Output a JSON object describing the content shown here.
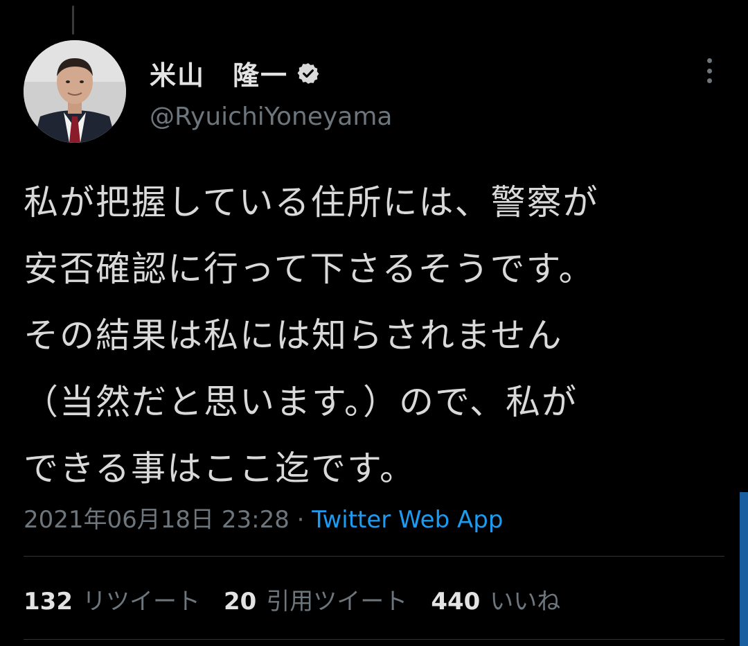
{
  "author": {
    "display_name": "米山　隆一",
    "handle": "@RyuichiYoneyama",
    "verified": true
  },
  "icons": {
    "avatar": "profile-photo",
    "verified": "verified-badge-icon",
    "more": "more-vertical-icon"
  },
  "tweet": {
    "lines": [
      "私が把握している住所には、警察が",
      "安否確認に行って下さるそうです。",
      "その結果は私には知らされません",
      "（当然だと思います。）ので、私が",
      "できる事はここ迄です。"
    ],
    "timestamp": "2021年06月18日 23:28",
    "separator": " · ",
    "source": "Twitter Web App"
  },
  "stats": {
    "retweets": {
      "count": "132",
      "label": "リツイート"
    },
    "quotes": {
      "count": "20",
      "label": "引用ツイート"
    },
    "likes": {
      "count": "440",
      "label": "いいね"
    }
  },
  "colors": {
    "background": "#000000",
    "text": "#d9d9d9",
    "secondary": "#6e767d",
    "link": "#1d9bf0",
    "divider": "#2f3336"
  }
}
